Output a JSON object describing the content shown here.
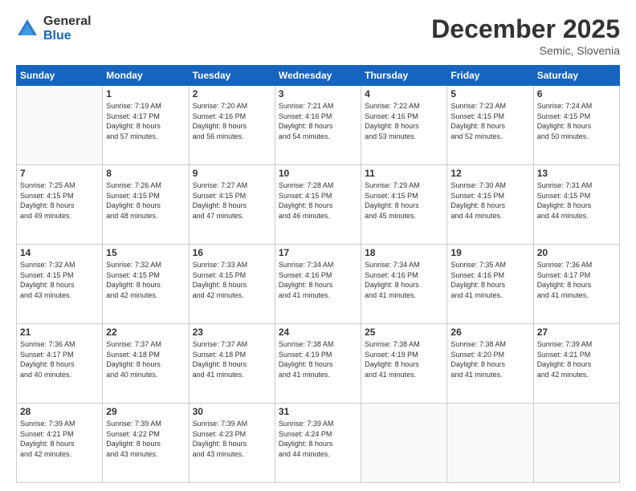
{
  "logo": {
    "general": "General",
    "blue": "Blue"
  },
  "header": {
    "month": "December 2025",
    "location": "Semic, Slovenia"
  },
  "weekdays": [
    "Sunday",
    "Monday",
    "Tuesday",
    "Wednesday",
    "Thursday",
    "Friday",
    "Saturday"
  ],
  "weeks": [
    [
      {
        "day": "",
        "content": ""
      },
      {
        "day": "1",
        "content": "Sunrise: 7:19 AM\nSunset: 4:17 PM\nDaylight: 8 hours\nand 57 minutes."
      },
      {
        "day": "2",
        "content": "Sunrise: 7:20 AM\nSunset: 4:16 PM\nDaylight: 8 hours\nand 56 minutes."
      },
      {
        "day": "3",
        "content": "Sunrise: 7:21 AM\nSunset: 4:16 PM\nDaylight: 8 hours\nand 54 minutes."
      },
      {
        "day": "4",
        "content": "Sunrise: 7:22 AM\nSunset: 4:16 PM\nDaylight: 8 hours\nand 53 minutes."
      },
      {
        "day": "5",
        "content": "Sunrise: 7:23 AM\nSunset: 4:15 PM\nDaylight: 8 hours\nand 52 minutes."
      },
      {
        "day": "6",
        "content": "Sunrise: 7:24 AM\nSunset: 4:15 PM\nDaylight: 8 hours\nand 50 minutes."
      }
    ],
    [
      {
        "day": "7",
        "content": "Sunrise: 7:25 AM\nSunset: 4:15 PM\nDaylight: 8 hours\nand 49 minutes."
      },
      {
        "day": "8",
        "content": "Sunrise: 7:26 AM\nSunset: 4:15 PM\nDaylight: 8 hours\nand 48 minutes."
      },
      {
        "day": "9",
        "content": "Sunrise: 7:27 AM\nSunset: 4:15 PM\nDaylight: 8 hours\nand 47 minutes."
      },
      {
        "day": "10",
        "content": "Sunrise: 7:28 AM\nSunset: 4:15 PM\nDaylight: 8 hours\nand 46 minutes."
      },
      {
        "day": "11",
        "content": "Sunrise: 7:29 AM\nSunset: 4:15 PM\nDaylight: 8 hours\nand 45 minutes."
      },
      {
        "day": "12",
        "content": "Sunrise: 7:30 AM\nSunset: 4:15 PM\nDaylight: 8 hours\nand 44 minutes."
      },
      {
        "day": "13",
        "content": "Sunrise: 7:31 AM\nSunset: 4:15 PM\nDaylight: 8 hours\nand 44 minutes."
      }
    ],
    [
      {
        "day": "14",
        "content": "Sunrise: 7:32 AM\nSunset: 4:15 PM\nDaylight: 8 hours\nand 43 minutes."
      },
      {
        "day": "15",
        "content": "Sunrise: 7:32 AM\nSunset: 4:15 PM\nDaylight: 8 hours\nand 42 minutes."
      },
      {
        "day": "16",
        "content": "Sunrise: 7:33 AM\nSunset: 4:15 PM\nDaylight: 8 hours\nand 42 minutes."
      },
      {
        "day": "17",
        "content": "Sunrise: 7:34 AM\nSunset: 4:16 PM\nDaylight: 8 hours\nand 41 minutes."
      },
      {
        "day": "18",
        "content": "Sunrise: 7:34 AM\nSunset: 4:16 PM\nDaylight: 8 hours\nand 41 minutes."
      },
      {
        "day": "19",
        "content": "Sunrise: 7:35 AM\nSunset: 4:16 PM\nDaylight: 8 hours\nand 41 minutes."
      },
      {
        "day": "20",
        "content": "Sunrise: 7:36 AM\nSunset: 4:17 PM\nDaylight: 8 hours\nand 41 minutes."
      }
    ],
    [
      {
        "day": "21",
        "content": "Sunrise: 7:36 AM\nSunset: 4:17 PM\nDaylight: 8 hours\nand 40 minutes."
      },
      {
        "day": "22",
        "content": "Sunrise: 7:37 AM\nSunset: 4:18 PM\nDaylight: 8 hours\nand 40 minutes."
      },
      {
        "day": "23",
        "content": "Sunrise: 7:37 AM\nSunset: 4:18 PM\nDaylight: 8 hours\nand 41 minutes."
      },
      {
        "day": "24",
        "content": "Sunrise: 7:38 AM\nSunset: 4:19 PM\nDaylight: 8 hours\nand 41 minutes."
      },
      {
        "day": "25",
        "content": "Sunrise: 7:38 AM\nSunset: 4:19 PM\nDaylight: 8 hours\nand 41 minutes."
      },
      {
        "day": "26",
        "content": "Sunrise: 7:38 AM\nSunset: 4:20 PM\nDaylight: 8 hours\nand 41 minutes."
      },
      {
        "day": "27",
        "content": "Sunrise: 7:39 AM\nSunset: 4:21 PM\nDaylight: 8 hours\nand 42 minutes."
      }
    ],
    [
      {
        "day": "28",
        "content": "Sunrise: 7:39 AM\nSunset: 4:21 PM\nDaylight: 8 hours\nand 42 minutes."
      },
      {
        "day": "29",
        "content": "Sunrise: 7:39 AM\nSunset: 4:22 PM\nDaylight: 8 hours\nand 43 minutes."
      },
      {
        "day": "30",
        "content": "Sunrise: 7:39 AM\nSunset: 4:23 PM\nDaylight: 8 hours\nand 43 minutes."
      },
      {
        "day": "31",
        "content": "Sunrise: 7:39 AM\nSunset: 4:24 PM\nDaylight: 8 hours\nand 44 minutes."
      },
      {
        "day": "",
        "content": ""
      },
      {
        "day": "",
        "content": ""
      },
      {
        "day": "",
        "content": ""
      }
    ]
  ]
}
